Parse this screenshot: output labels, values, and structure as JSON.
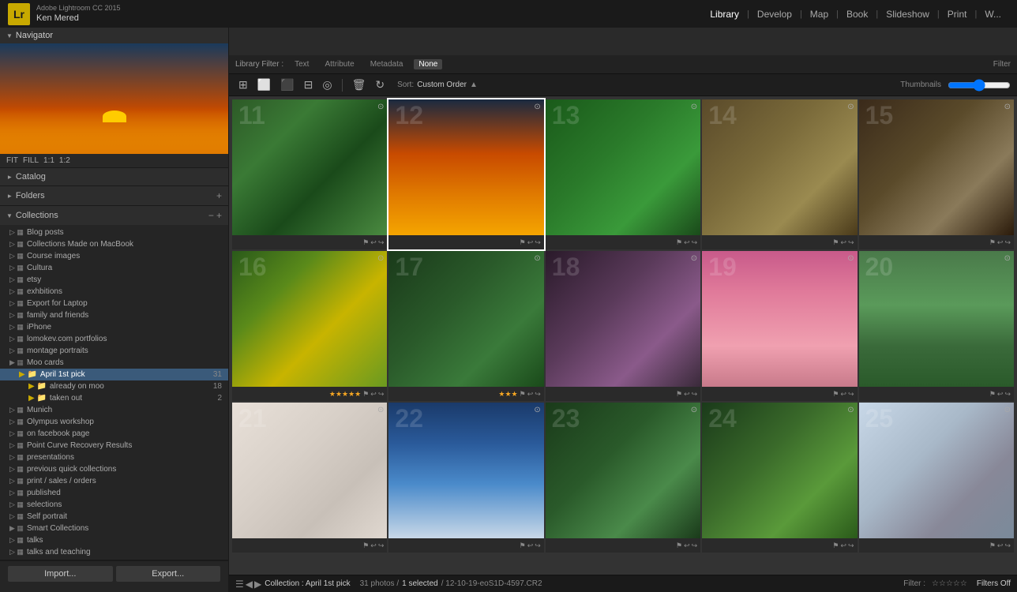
{
  "app": {
    "name": "Adobe Lightroom CC 2015",
    "logo": "Lr",
    "user": "Ken  Mered"
  },
  "nav": {
    "items": [
      "Library",
      "Develop",
      "Map",
      "Book",
      "Slideshow",
      "Print",
      "W..."
    ],
    "active": "Library"
  },
  "navigator": {
    "label": "Navigator",
    "zoom_options": [
      "FIT",
      "FILL",
      "1:1",
      "1:2"
    ]
  },
  "catalog": {
    "label": "Catalog"
  },
  "folders": {
    "label": "Folders"
  },
  "collections": {
    "label": "Collections",
    "items": [
      {
        "name": "Blog posts",
        "type": "collection",
        "level": 1
      },
      {
        "name": "Collections Made on MacBook",
        "type": "collection",
        "level": 1
      },
      {
        "name": "Course images",
        "type": "collection",
        "level": 1
      },
      {
        "name": "Cultura",
        "type": "collection",
        "level": 1
      },
      {
        "name": "etsy",
        "type": "collection",
        "level": 1
      },
      {
        "name": "exhbitions",
        "type": "collection",
        "level": 1
      },
      {
        "name": "Export for Laptop",
        "type": "collection",
        "level": 1
      },
      {
        "name": "family and friends",
        "type": "collection",
        "level": 1
      },
      {
        "name": "iPhone",
        "type": "collection",
        "level": 1
      },
      {
        "name": "lomokev.com portfolios",
        "type": "collection",
        "level": 1
      },
      {
        "name": "montage portraits",
        "type": "collection",
        "level": 1
      },
      {
        "name": "Moo cards",
        "type": "collection-set",
        "level": 1
      },
      {
        "name": "April 1st pick",
        "type": "folder",
        "level": 2,
        "count": 31,
        "active": true
      },
      {
        "name": "already on moo",
        "type": "folder",
        "level": 3,
        "count": 18
      },
      {
        "name": "taken out",
        "type": "folder",
        "level": 3,
        "count": 2
      },
      {
        "name": "Munich",
        "type": "collection",
        "level": 1
      },
      {
        "name": "Olympus workshop",
        "type": "collection",
        "level": 1
      },
      {
        "name": "on facebook page",
        "type": "collection",
        "level": 1
      },
      {
        "name": "Point Curve Recovery Results",
        "type": "collection",
        "level": 1
      },
      {
        "name": "presentations",
        "type": "collection",
        "level": 1
      },
      {
        "name": "previous quick collections",
        "type": "collection",
        "level": 1
      },
      {
        "name": "print / sales / orders",
        "type": "collection",
        "level": 1
      },
      {
        "name": "published",
        "type": "collection",
        "level": 1
      },
      {
        "name": "selections",
        "type": "collection",
        "level": 1
      },
      {
        "name": "Self portrait",
        "type": "collection",
        "level": 1
      },
      {
        "name": "Smart Collections",
        "type": "collection-set",
        "level": 1
      },
      {
        "name": "talks",
        "type": "collection",
        "level": 1
      },
      {
        "name": "talks and teaching",
        "type": "collection",
        "level": 1
      }
    ]
  },
  "import_btn": "Import...",
  "export_btn": "Export...",
  "filter_bar": {
    "label": "Library Filter :",
    "tabs": [
      "Text",
      "Attribute",
      "Metadata",
      "None"
    ],
    "active": "None"
  },
  "toolbar": {
    "sort_label": "Sort:",
    "sort_value": "Custom Order",
    "thumb_label": "Thumbnails"
  },
  "photos": [
    {
      "number": "11",
      "bg": "flower-blue",
      "stars": 0,
      "selected": false,
      "empty": false
    },
    {
      "number": "12",
      "bg": "sunset",
      "stars": 0,
      "selected": true,
      "empty": false
    },
    {
      "number": "13",
      "bg": "leaf",
      "stars": 0,
      "selected": false,
      "empty": false
    },
    {
      "number": "14",
      "bg": "caterpillar",
      "stars": 0,
      "selected": false,
      "empty": false
    },
    {
      "number": "15",
      "bg": "snail",
      "stars": 0,
      "selected": false,
      "empty": false
    },
    {
      "number": "16",
      "bg": "yellow-flower",
      "stars": 5,
      "selected": false,
      "empty": false
    },
    {
      "number": "17",
      "bg": "leaves",
      "stars": 3,
      "selected": false,
      "empty": false
    },
    {
      "number": "18",
      "bg": "buds",
      "stars": 0,
      "selected": false,
      "empty": false
    },
    {
      "number": "19",
      "bg": "clouds",
      "stars": 0,
      "selected": false,
      "empty": false
    },
    {
      "number": "20",
      "bg": "lake",
      "stars": 0,
      "selected": false,
      "empty": false
    },
    {
      "number": "21",
      "bg": "pregnancy",
      "stars": 0,
      "selected": false,
      "empty": false
    },
    {
      "number": "22",
      "bg": "sky",
      "stars": 0,
      "selected": false,
      "empty": false
    },
    {
      "number": "23",
      "bg": "bowl",
      "stars": 0,
      "selected": false,
      "empty": false
    },
    {
      "number": "24",
      "bg": "succulent",
      "stars": 0,
      "selected": false,
      "empty": false
    },
    {
      "number": "25",
      "bg": "man",
      "stars": 0,
      "selected": false,
      "empty": false
    }
  ],
  "status": {
    "collection_label": "Collection : April 1st pick",
    "photos_label": "31 photos /",
    "selected_label": "1 selected",
    "file_label": "/ 12-10-19-eoS1D-4597.CR2",
    "filter_label": "Filter :",
    "filters_off": "Filters Off"
  }
}
